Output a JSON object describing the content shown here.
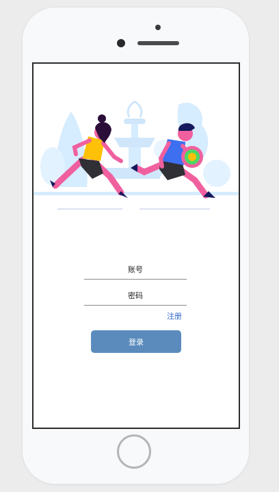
{
  "login_form": {
    "account_placeholder": "账号",
    "password_placeholder": "密码",
    "register_link": "注册",
    "login_button": "登录"
  },
  "colors": {
    "login_button": "#5b8bbd",
    "register_link": "#2f66c8",
    "illustration_light_blue": "#d6ecff"
  },
  "illustration": {
    "subject": "two-people-running-past-fountain"
  }
}
